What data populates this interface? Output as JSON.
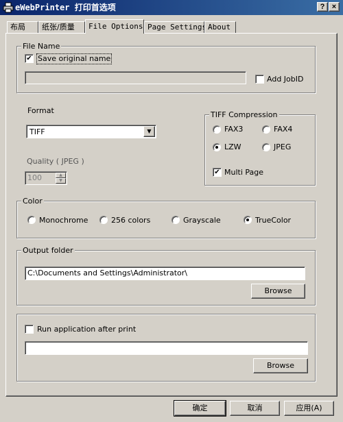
{
  "window": {
    "title": "eWebPrinter 打印首选项",
    "help_glyph": "?",
    "close_glyph": "×"
  },
  "tabs": [
    {
      "label": "布局"
    },
    {
      "label": "纸张/质量"
    },
    {
      "label": "File Options"
    },
    {
      "label": "Page Settings"
    },
    {
      "label": "About"
    }
  ],
  "file_name": {
    "group_label": "File Name",
    "save_original_label": "Save original name",
    "save_original_checked": true,
    "filename_value": "",
    "add_jobid_label": "Add JobID",
    "add_jobid_checked": false
  },
  "format": {
    "label": "Format",
    "selected": "TIFF",
    "quality_label": "Quality ( JPEG )",
    "quality_value": "100"
  },
  "tiff_compression": {
    "group_label": "TIFF Compression",
    "options": [
      "FAX3",
      "FAX4",
      "LZW",
      "JPEG"
    ],
    "selected": "LZW",
    "multi_page_label": "Multi Page",
    "multi_page_checked": true
  },
  "color": {
    "group_label": "Color",
    "options": [
      "Monochrome",
      "256 colors",
      "Grayscale",
      "TrueColor"
    ],
    "selected": "TrueColor"
  },
  "output_folder": {
    "group_label": "Output folder",
    "path": "C:\\Documents and Settings\\Administrator\\",
    "browse_label": "Browse"
  },
  "run_app": {
    "label": "Run application after print",
    "checked": false,
    "path": "",
    "browse_label": "Browse"
  },
  "footer": {
    "ok_label": "确定",
    "cancel_label": "取消",
    "apply_label": "应用(A)"
  },
  "glyphs": {
    "check": "✔",
    "dropdown": "▼",
    "spin_up": "▲",
    "spin_down": "▼"
  },
  "colors": {
    "titlebar_start": "#0a246a",
    "titlebar_end": "#3a6ea5",
    "face": "#d4d0c8"
  }
}
